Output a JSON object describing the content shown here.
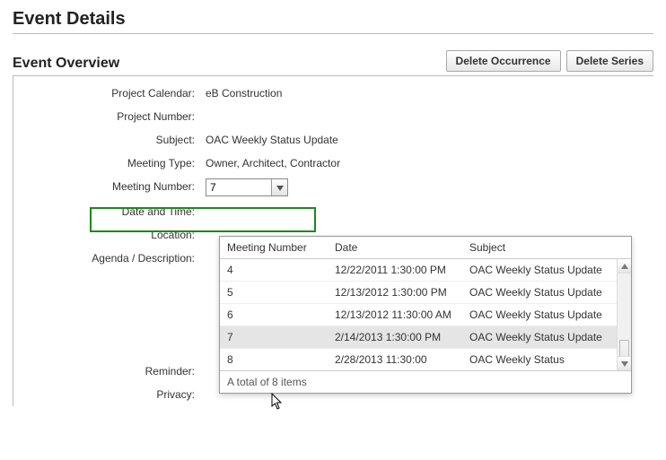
{
  "page": {
    "title": "Event Details"
  },
  "section": {
    "title": "Event Overview"
  },
  "buttons": {
    "delete_occurrence": "Delete Occurrence",
    "delete_series": "Delete Series"
  },
  "labels": {
    "project_calendar": "Project Calendar:",
    "project_number": "Project Number:",
    "subject": "Subject:",
    "meeting_type": "Meeting Type:",
    "meeting_number": "Meeting Number:",
    "date_time": "Date and Time:",
    "location": "Location:",
    "agenda": "Agenda / Description:",
    "reminder": "Reminder:",
    "privacy": "Privacy:"
  },
  "values": {
    "project_calendar": "eB Construction",
    "project_number": "",
    "subject": "OAC Weekly Status Update",
    "meeting_type": "Owner, Architect, Contractor",
    "meeting_number": "7",
    "date_time": "",
    "location": "",
    "agenda": "",
    "reminder": "",
    "privacy": ""
  },
  "dropdown": {
    "columns": {
      "number": "Meeting Number",
      "date": "Date",
      "subject": "Subject"
    },
    "rows": [
      {
        "number": "4",
        "date": "12/22/2011 1:30:00 PM",
        "subject": "OAC Weekly Status Update",
        "selected": false
      },
      {
        "number": "5",
        "date": "12/13/2012 1:30:00 PM",
        "subject": "OAC Weekly Status Update",
        "selected": false
      },
      {
        "number": "6",
        "date": "12/13/2012 11:30:00 AM",
        "subject": "OAC Weekly Status Update",
        "selected": false
      },
      {
        "number": "7",
        "date": "2/14/2013 1:30:00 PM",
        "subject": "OAC Weekly Status Update",
        "selected": true
      },
      {
        "number": "8",
        "date": "2/28/2013 11:30:00",
        "subject": "OAC Weekly Status",
        "selected": false
      }
    ],
    "footer": "A total of 8 items"
  }
}
